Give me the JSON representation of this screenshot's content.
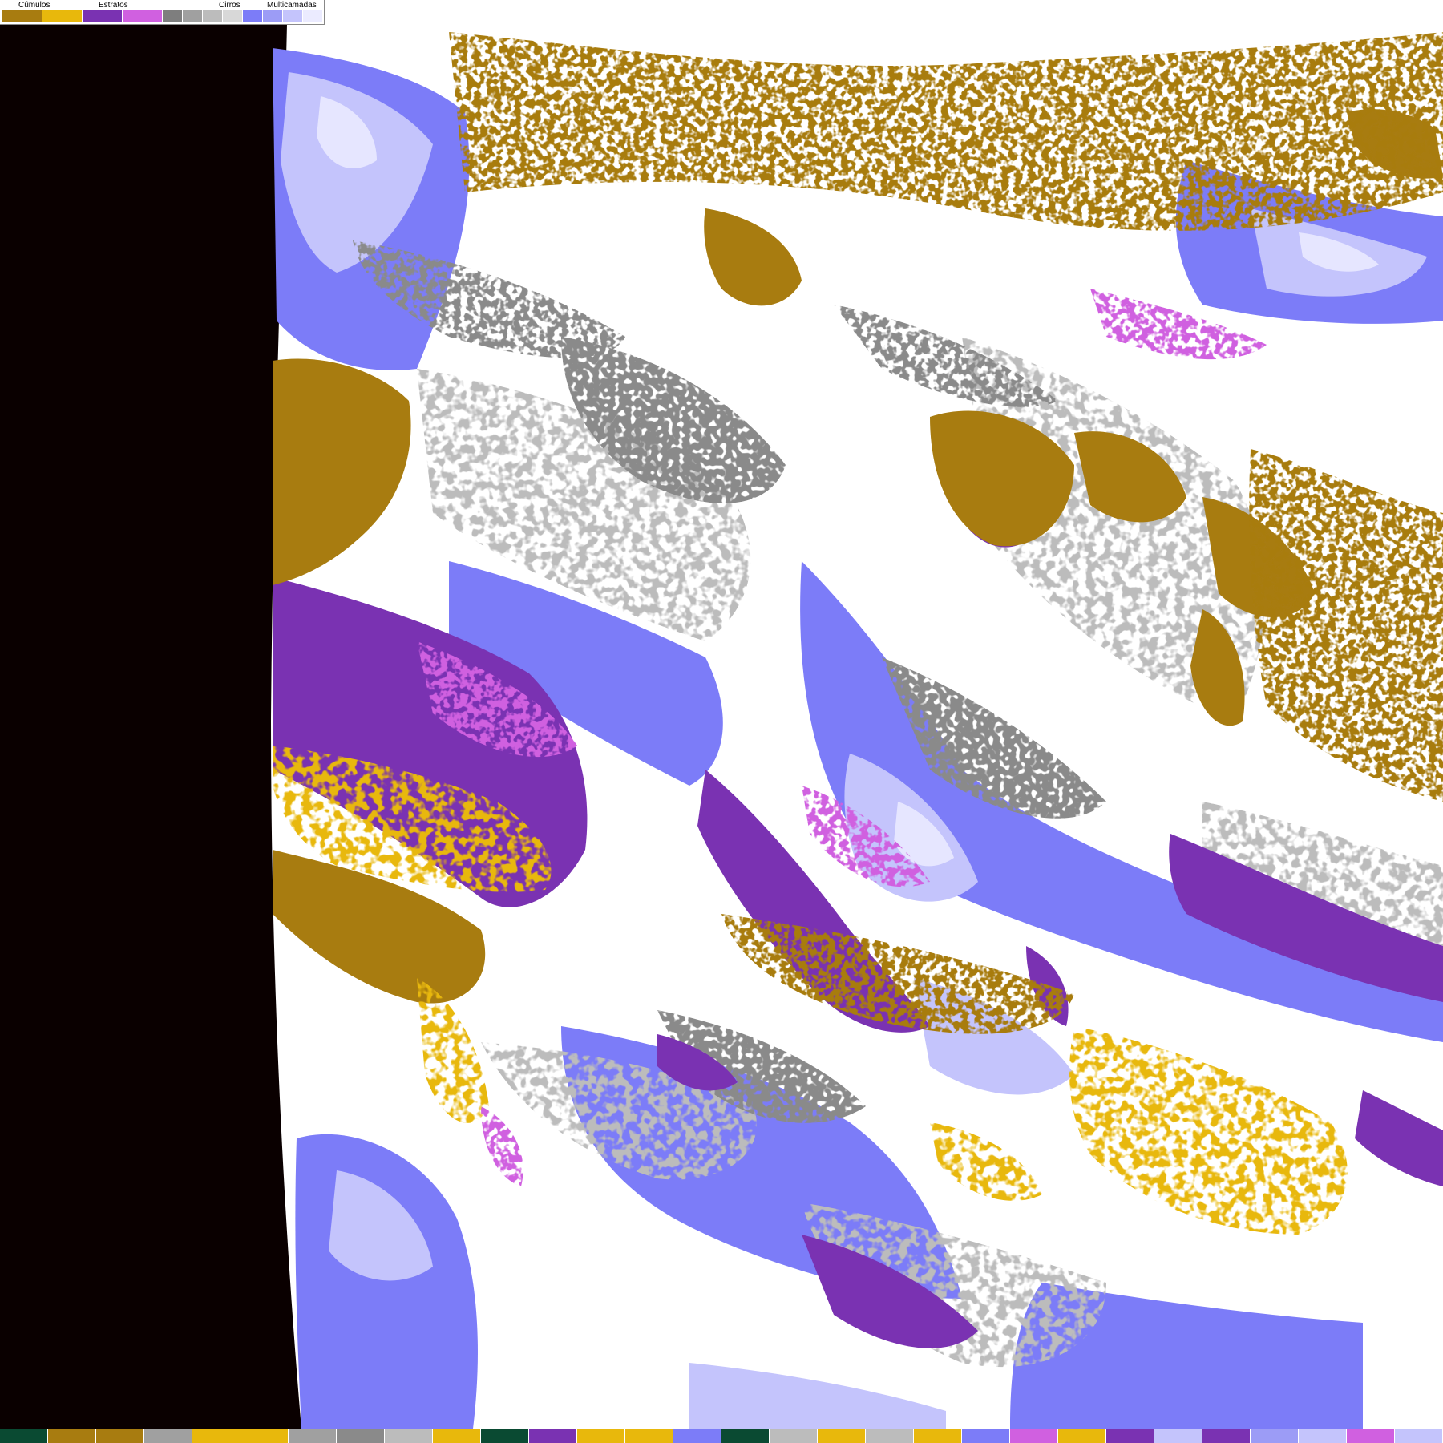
{
  "legend": {
    "groups": [
      {
        "label": "Cúmulos",
        "colors": [
          "#a87c10",
          "#e8b80c"
        ]
      },
      {
        "label": "Estratos",
        "colors": [
          "#7a32b2",
          "#d060e0"
        ]
      },
      {
        "label": "Cirros",
        "colors": [
          "#7e7e7e",
          "#a0a0a0",
          "#bcbcbc",
          "#d8d8d8"
        ]
      },
      {
        "label": "Multicamadas",
        "colors": [
          "#7c7cf8",
          "#9c9cf6",
          "#c4c4fc",
          "#ebebff"
        ]
      }
    ]
  },
  "palette": {
    "space": "#0a0000",
    "clear": "#ffffff",
    "cumulus_low": "#a87c10",
    "cumulus_high": "#e8b80c",
    "stratus": "#7a32b2",
    "stratus_light": "#d060e0",
    "cirrus_dark": "#8a8a8a",
    "cirrus_light": "#bcbcbc",
    "multi_dark": "#7c7cf8",
    "multi_light": "#c4c4fc",
    "multi_pale": "#e6e6ff"
  },
  "bottom_strip": {
    "colors": [
      "#0a4a32",
      "#a87c10",
      "#a87c10",
      "#a0a0a0",
      "#e8b80c",
      "#e8b80c",
      "#a0a0a0",
      "#8a8a8a",
      "#bcbcbc",
      "#e8b80c",
      "#0a4a32",
      "#7a32b2",
      "#e8b80c",
      "#e8b80c",
      "#7c7cf8",
      "#0a4a32",
      "#bcbcbc",
      "#e8b80c",
      "#bcbcbc",
      "#e8b80c",
      "#7c7cf8",
      "#d060e0",
      "#e8b80c",
      "#7a32b2",
      "#c4c4fc",
      "#7a32b2",
      "#9c9cf6",
      "#c4c4fc",
      "#d060e0",
      "#c4c4fc"
    ]
  }
}
